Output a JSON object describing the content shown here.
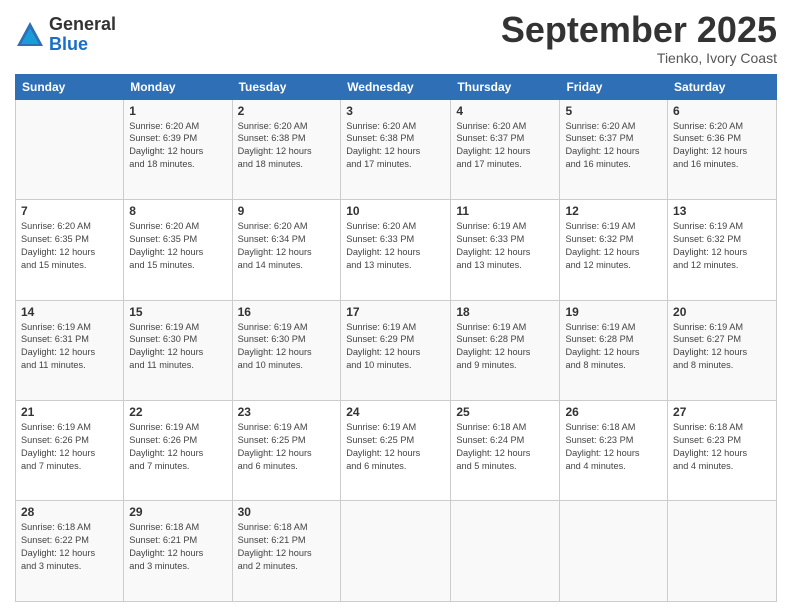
{
  "header": {
    "logo_general": "General",
    "logo_blue": "Blue",
    "month_title": "September 2025",
    "subtitle": "Tienko, Ivory Coast"
  },
  "weekdays": [
    "Sunday",
    "Monday",
    "Tuesday",
    "Wednesday",
    "Thursday",
    "Friday",
    "Saturday"
  ],
  "weeks": [
    [
      {
        "day": "",
        "info": ""
      },
      {
        "day": "1",
        "info": "Sunrise: 6:20 AM\nSunset: 6:39 PM\nDaylight: 12 hours\nand 18 minutes."
      },
      {
        "day": "2",
        "info": "Sunrise: 6:20 AM\nSunset: 6:38 PM\nDaylight: 12 hours\nand 18 minutes."
      },
      {
        "day": "3",
        "info": "Sunrise: 6:20 AM\nSunset: 6:38 PM\nDaylight: 12 hours\nand 17 minutes."
      },
      {
        "day": "4",
        "info": "Sunrise: 6:20 AM\nSunset: 6:37 PM\nDaylight: 12 hours\nand 17 minutes."
      },
      {
        "day": "5",
        "info": "Sunrise: 6:20 AM\nSunset: 6:37 PM\nDaylight: 12 hours\nand 16 minutes."
      },
      {
        "day": "6",
        "info": "Sunrise: 6:20 AM\nSunset: 6:36 PM\nDaylight: 12 hours\nand 16 minutes."
      }
    ],
    [
      {
        "day": "7",
        "info": "Sunrise: 6:20 AM\nSunset: 6:35 PM\nDaylight: 12 hours\nand 15 minutes."
      },
      {
        "day": "8",
        "info": "Sunrise: 6:20 AM\nSunset: 6:35 PM\nDaylight: 12 hours\nand 15 minutes."
      },
      {
        "day": "9",
        "info": "Sunrise: 6:20 AM\nSunset: 6:34 PM\nDaylight: 12 hours\nand 14 minutes."
      },
      {
        "day": "10",
        "info": "Sunrise: 6:20 AM\nSunset: 6:33 PM\nDaylight: 12 hours\nand 13 minutes."
      },
      {
        "day": "11",
        "info": "Sunrise: 6:19 AM\nSunset: 6:33 PM\nDaylight: 12 hours\nand 13 minutes."
      },
      {
        "day": "12",
        "info": "Sunrise: 6:19 AM\nSunset: 6:32 PM\nDaylight: 12 hours\nand 12 minutes."
      },
      {
        "day": "13",
        "info": "Sunrise: 6:19 AM\nSunset: 6:32 PM\nDaylight: 12 hours\nand 12 minutes."
      }
    ],
    [
      {
        "day": "14",
        "info": "Sunrise: 6:19 AM\nSunset: 6:31 PM\nDaylight: 12 hours\nand 11 minutes."
      },
      {
        "day": "15",
        "info": "Sunrise: 6:19 AM\nSunset: 6:30 PM\nDaylight: 12 hours\nand 11 minutes."
      },
      {
        "day": "16",
        "info": "Sunrise: 6:19 AM\nSunset: 6:30 PM\nDaylight: 12 hours\nand 10 minutes."
      },
      {
        "day": "17",
        "info": "Sunrise: 6:19 AM\nSunset: 6:29 PM\nDaylight: 12 hours\nand 10 minutes."
      },
      {
        "day": "18",
        "info": "Sunrise: 6:19 AM\nSunset: 6:28 PM\nDaylight: 12 hours\nand 9 minutes."
      },
      {
        "day": "19",
        "info": "Sunrise: 6:19 AM\nSunset: 6:28 PM\nDaylight: 12 hours\nand 8 minutes."
      },
      {
        "day": "20",
        "info": "Sunrise: 6:19 AM\nSunset: 6:27 PM\nDaylight: 12 hours\nand 8 minutes."
      }
    ],
    [
      {
        "day": "21",
        "info": "Sunrise: 6:19 AM\nSunset: 6:26 PM\nDaylight: 12 hours\nand 7 minutes."
      },
      {
        "day": "22",
        "info": "Sunrise: 6:19 AM\nSunset: 6:26 PM\nDaylight: 12 hours\nand 7 minutes."
      },
      {
        "day": "23",
        "info": "Sunrise: 6:19 AM\nSunset: 6:25 PM\nDaylight: 12 hours\nand 6 minutes."
      },
      {
        "day": "24",
        "info": "Sunrise: 6:19 AM\nSunset: 6:25 PM\nDaylight: 12 hours\nand 6 minutes."
      },
      {
        "day": "25",
        "info": "Sunrise: 6:18 AM\nSunset: 6:24 PM\nDaylight: 12 hours\nand 5 minutes."
      },
      {
        "day": "26",
        "info": "Sunrise: 6:18 AM\nSunset: 6:23 PM\nDaylight: 12 hours\nand 4 minutes."
      },
      {
        "day": "27",
        "info": "Sunrise: 6:18 AM\nSunset: 6:23 PM\nDaylight: 12 hours\nand 4 minutes."
      }
    ],
    [
      {
        "day": "28",
        "info": "Sunrise: 6:18 AM\nSunset: 6:22 PM\nDaylight: 12 hours\nand 3 minutes."
      },
      {
        "day": "29",
        "info": "Sunrise: 6:18 AM\nSunset: 6:21 PM\nDaylight: 12 hours\nand 3 minutes."
      },
      {
        "day": "30",
        "info": "Sunrise: 6:18 AM\nSunset: 6:21 PM\nDaylight: 12 hours\nand 2 minutes."
      },
      {
        "day": "",
        "info": ""
      },
      {
        "day": "",
        "info": ""
      },
      {
        "day": "",
        "info": ""
      },
      {
        "day": "",
        "info": ""
      }
    ]
  ]
}
